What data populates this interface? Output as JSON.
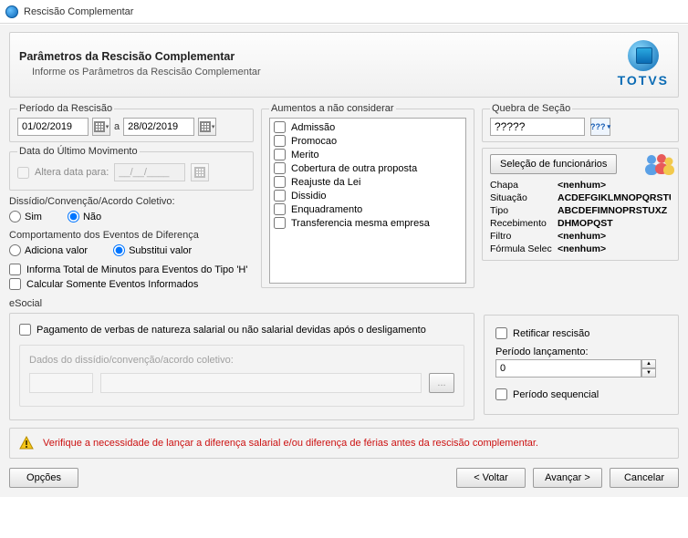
{
  "window": {
    "title": "Rescisão Complementar"
  },
  "header": {
    "title": "Parâmetros da Rescisão Complementar",
    "subtitle": "Informe os Parâmetros da Rescisão Complementar",
    "brand": "TOTVS"
  },
  "periodo": {
    "legend": "Período da Rescisão",
    "start": "01/02/2019",
    "sep": "a",
    "end": "28/02/2019"
  },
  "ultimo_mov": {
    "legend": "Data do Último Movimento",
    "check_label": "Altera data para:",
    "value": "__/__/____"
  },
  "dissidio": {
    "label": "Dissídio/Convenção/Acordo Coletivo:",
    "opt_yes": "Sim",
    "opt_no": "Não",
    "selected": "no"
  },
  "comportamento": {
    "label": "Comportamento dos Eventos de Diferença",
    "opt_add": "Adiciona valor",
    "opt_sub": "Substitui valor",
    "selected": "sub"
  },
  "extras": {
    "minutos": "Informa Total de Minutos para Eventos do Tipo 'H'",
    "calcular": "Calcular Somente Eventos Informados"
  },
  "aumentos": {
    "legend": "Aumentos a não considerar",
    "items": [
      "Admissão",
      "Promocao",
      "Merito",
      "Cobertura de outra proposta",
      "Reajuste da Lei",
      "Dissidio",
      "Enquadramento",
      "Transferencia mesma empresa"
    ]
  },
  "quebra": {
    "legend": "Quebra de Seção",
    "value": "?????",
    "btn": "???"
  },
  "selecao": {
    "button": "Seleção de funcionários",
    "rows": {
      "Chapa": "<nenhum>",
      "Situação": "ACDEFGIKLMNOPQRSTU",
      "Tipo": "ABCDEFIMNOPRSTUXZ",
      "Recebimento": "DHMOPQST",
      "Filtro": "<nenhum>",
      "Fórmula Selec": "<nenhum>"
    }
  },
  "esocial": {
    "title": "eSocial",
    "pagamento": "Pagamento de verbas de natureza salarial ou não salarial devidas após o desligamento",
    "dados_label": "Dados do dissídio/convenção/acordo coletivo:",
    "retificar": "Retificar rescisão",
    "periodo_label": "Período lançamento:",
    "periodo_value": "0",
    "periodo_seq": "Período sequencial"
  },
  "warning": "Verifique a necessidade de lançar a diferença salarial e/ou diferença de férias antes da rescisão complementar.",
  "footer": {
    "opcoes": "Opções",
    "back": "< Voltar",
    "next": "Avançar >",
    "cancel": "Cancelar"
  }
}
